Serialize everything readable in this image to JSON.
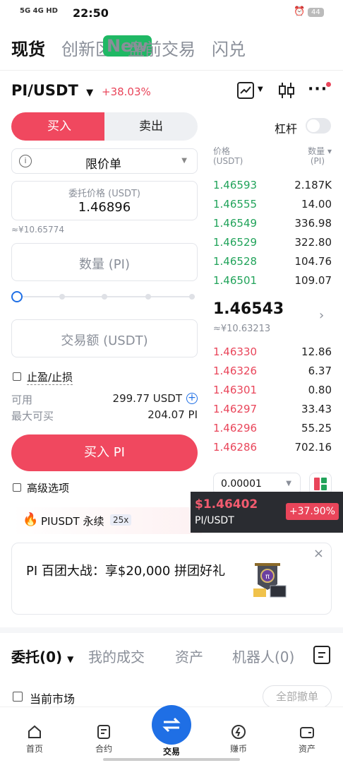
{
  "status_bar": {
    "left": "5G  4G  HD",
    "time": "22:50",
    "battery": "44"
  },
  "top_tabs": [
    {
      "label": "现货",
      "active": true
    },
    {
      "label": "创新区",
      "badge": "New"
    },
    {
      "label": "盘前交易"
    },
    {
      "label": "闪兑"
    }
  ],
  "pair": {
    "symbol": "PI/USDT",
    "change": "+38.03%"
  },
  "order_form": {
    "buy_label": "买入",
    "sell_label": "卖出",
    "leverage_label": "杠杆",
    "order_type": "限价单",
    "price_label": "委托价格 (USDT)",
    "price_value": "1.46896",
    "price_cny": "≈¥10.65774",
    "qty_placeholder": "数量 (PI)",
    "amount_placeholder": "交易额 (USDT)",
    "tpsl_label": "止盈/止损",
    "available_label": "可用",
    "available_value": "299.77 USDT",
    "max_buy_label": "最大可买",
    "max_buy_value": "204.07 PI",
    "submit_label": "买入 PI",
    "advanced_label": "高级选项"
  },
  "orderbook": {
    "price_header": "价格",
    "price_unit": "(USDT)",
    "qty_header": "数量",
    "qty_unit": "(PI)",
    "asks": [
      {
        "price": "1.46593",
        "qty": "2.187K"
      },
      {
        "price": "1.46555",
        "qty": "14.00"
      },
      {
        "price": "1.46549",
        "qty": "336.98"
      },
      {
        "price": "1.46529",
        "qty": "322.80"
      },
      {
        "price": "1.46528",
        "qty": "104.76"
      },
      {
        "price": "1.46501",
        "qty": "109.07"
      }
    ],
    "last_price": "1.46543",
    "last_cny": "≈¥10.63213",
    "bids": [
      {
        "price": "1.46330",
        "qty": "12.86"
      },
      {
        "price": "1.46326",
        "qty": "6.37"
      },
      {
        "price": "1.46301",
        "qty": "0.80"
      },
      {
        "price": "1.46297",
        "qty": "33.43"
      },
      {
        "price": "1.46296",
        "qty": "55.25"
      },
      {
        "price": "1.46286",
        "qty": "702.16"
      }
    ],
    "precision": "0.00001"
  },
  "perp": {
    "name": "PIUSDT 永续",
    "leverage": "25x"
  },
  "ticker_popup": {
    "price": "$1.46402",
    "pair": "PI/USDT",
    "change": "+37.90%"
  },
  "banner": {
    "text": "PI 百团大战：享$20,000 拼团好礼"
  },
  "bottom_tabs": [
    {
      "label": "委托(0)",
      "active": true
    },
    {
      "label": "我的成交"
    },
    {
      "label": "资产"
    },
    {
      "label": "机器人(0)"
    }
  ],
  "current_market_label": "当前市场",
  "cancel_all_label": "全部撤单",
  "nav": [
    {
      "label": "首页"
    },
    {
      "label": "合约"
    },
    {
      "label": "交易"
    },
    {
      "label": "赚币"
    },
    {
      "label": "资产"
    }
  ],
  "colors": {
    "buy": "#f0485f",
    "sell_bg": "#eef0f3",
    "ask": "#21a35a",
    "bid": "#e9455a",
    "accent": "#1f6fe5"
  }
}
